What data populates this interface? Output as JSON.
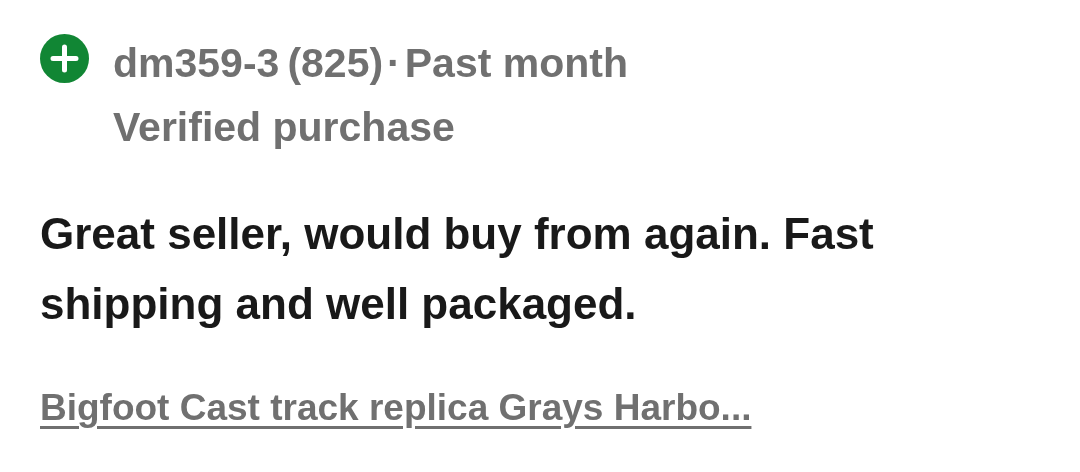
{
  "review": {
    "rating": {
      "kind": "positive"
    },
    "username": "dm359-3",
    "score": "(825)",
    "separator": "·",
    "time": "Past month",
    "verified": "Verified purchase",
    "comment": "Great seller, would buy from again. Fast shipping and well packaged.",
    "item_link": "Bigfoot Cast track replica Grays Harbo..."
  }
}
